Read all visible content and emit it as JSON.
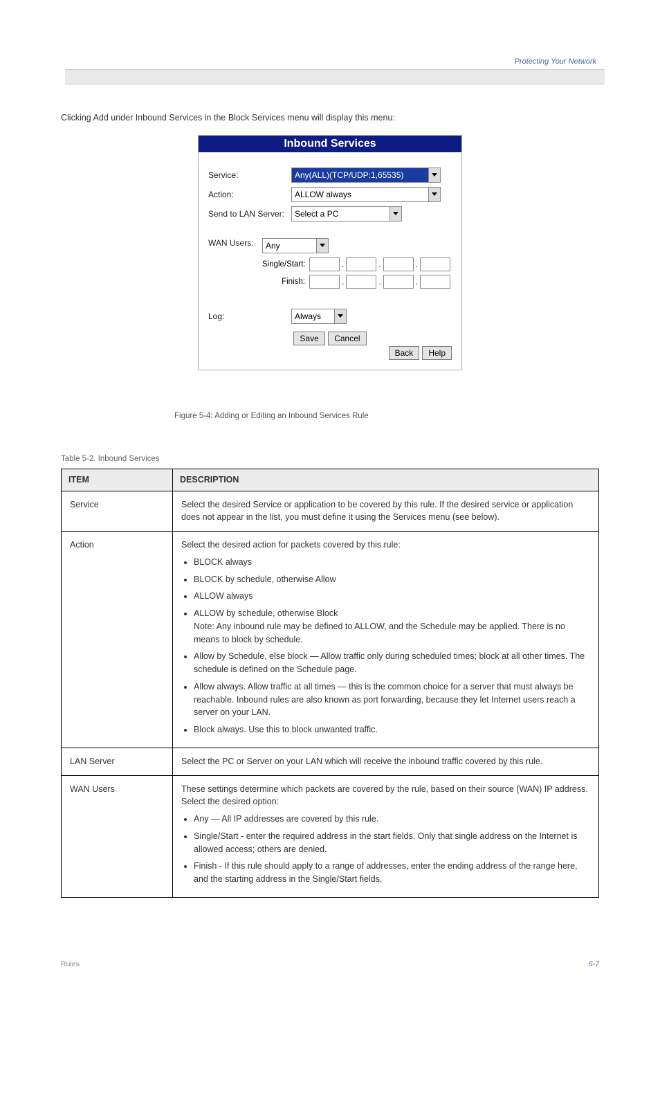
{
  "topbar_right": "Protecting Your Network",
  "intro": "Clicking Add under Inbound Services in the Block Services menu will display this menu:",
  "panel": {
    "title": "Inbound Services",
    "rows": {
      "service_label": "Service:",
      "service_value": "Any(ALL)(TCP/UDP:1,65535)",
      "action_label": "Action:",
      "action_value": "ALLOW always",
      "lan_label": "Send to LAN Server:",
      "lan_value": "Select a PC",
      "wan_label": "WAN Users:",
      "wan_value": "Any",
      "single_label": "Single/Start:",
      "finish_label": "Finish:",
      "log_label": "Log:",
      "log_value": "Always"
    },
    "buttons": {
      "save": "Save",
      "cancel": "Cancel",
      "back": "Back",
      "help": "Help"
    }
  },
  "figure_caption": "Figure 5-4:    Adding or Editing an Inbound Services Rule",
  "table_caption": "Table 5-2. Inbound Services",
  "table": {
    "h1": "ITEM",
    "h2": "DESCRIPTION",
    "r1_item": "Service",
    "r1_desc": "Select the desired Service or application to be covered by this rule. If the desired service or application does not appear in the list, you must define it using the Services menu (see below).",
    "r2_item": "Action",
    "r2_desc_lead": "Select the desired action for packets covered by this rule:",
    "r2_b1": "BLOCK always",
    "r2_b2": "BLOCK by schedule, otherwise Allow",
    "r2_b3": "ALLOW always",
    "r2_b4": "ALLOW by schedule, otherwise Block",
    "r2_note": "Note: Any inbound rule may be defined to ALLOW, and the Schedule may be applied. There is no means to block by schedule.",
    "r2_b5": "Allow by Schedule, else block — Allow traffic only during scheduled times; block at all other times. The schedule is defined on the Schedule page.",
    "r2_b6": "Allow always. Allow traffic at all times — this is the common choice for a server that must always be reachable. Inbound rules are also known as port forwarding, because they let Internet users reach a server on your LAN.",
    "r2_b7": "Block always. Use this to block unwanted traffic.",
    "r3_item": "LAN Server",
    "r3_desc": "Select the PC or Server on your LAN which will receive the inbound traffic covered by this rule.",
    "r4_item": "WAN Users",
    "r4_desc_lead": "These settings determine which packets are covered by the rule, based on their source (WAN) IP address. Select the desired option:",
    "r4_b1": "Any — All IP addresses are covered by this rule.",
    "r4_b2": "Single/Start - enter the required address in the start fields. Only that single address on the Internet is allowed access; others are denied.",
    "r4_b3": "Finish - If this rule should apply to a range of addresses, enter the ending address of the range here, and the starting address in the Single/Start fields."
  },
  "footer_left": "Rules",
  "footer_right": "5-7"
}
